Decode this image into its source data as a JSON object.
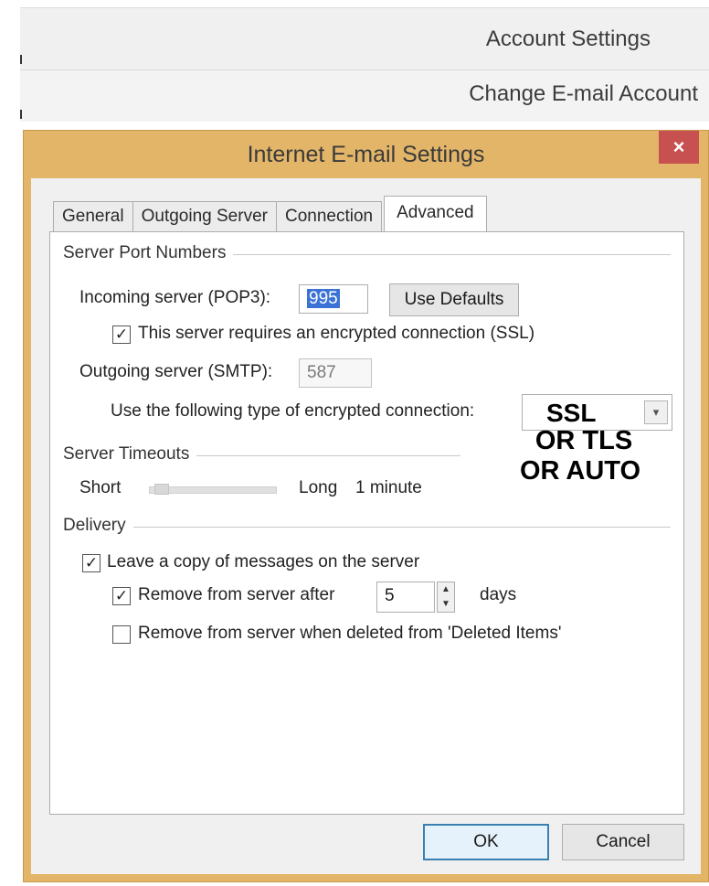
{
  "background_windows": {
    "account_settings_title": "Account Settings",
    "change_email_title": "Change E-mail Account"
  },
  "dialog": {
    "title": "Internet E-mail Settings",
    "close_glyph": "×",
    "tabs": [
      {
        "label": "General",
        "active": false
      },
      {
        "label": "Outgoing Server",
        "active": false
      },
      {
        "label": "Connection",
        "active": false
      },
      {
        "label": "Advanced",
        "active": true
      }
    ],
    "server_ports": {
      "heading": "Server Port Numbers",
      "incoming_label": "Incoming server (POP3):",
      "incoming_value": "995",
      "use_defaults_label": "Use Defaults",
      "ssl_checkbox_label": "This server requires an encrypted connection (SSL)",
      "ssl_checked": true,
      "outgoing_label": "Outgoing server (SMTP):",
      "outgoing_value": "587",
      "encryption_label": "Use the following type of encrypted connection:",
      "encryption_value": "SSL",
      "annotation_line1": "OR TLS",
      "annotation_line2": "OR AUTO"
    },
    "timeouts": {
      "heading": "Server Timeouts",
      "short_label": "Short",
      "long_label": "Long",
      "value": "1 minute"
    },
    "delivery": {
      "heading": "Delivery",
      "leave_copy_label": "Leave a copy of messages on the server",
      "leave_copy_checked": true,
      "remove_after_label": "Remove from server after",
      "remove_after_checked": true,
      "remove_after_days": "5",
      "days_label": "days",
      "remove_deleted_label": "Remove from server when deleted from 'Deleted Items'",
      "remove_deleted_checked": false
    },
    "ok_label": "OK",
    "cancel_label": "Cancel"
  },
  "icons": {
    "check": "✓",
    "chevron_down": "▾",
    "spin_up": "▲",
    "spin_down": "▼"
  },
  "colors": {
    "dialog_frame": "#e3b569",
    "close_button": "#c75050",
    "selection": "#3a72d6",
    "primary_button_border": "#3c7fb1"
  }
}
